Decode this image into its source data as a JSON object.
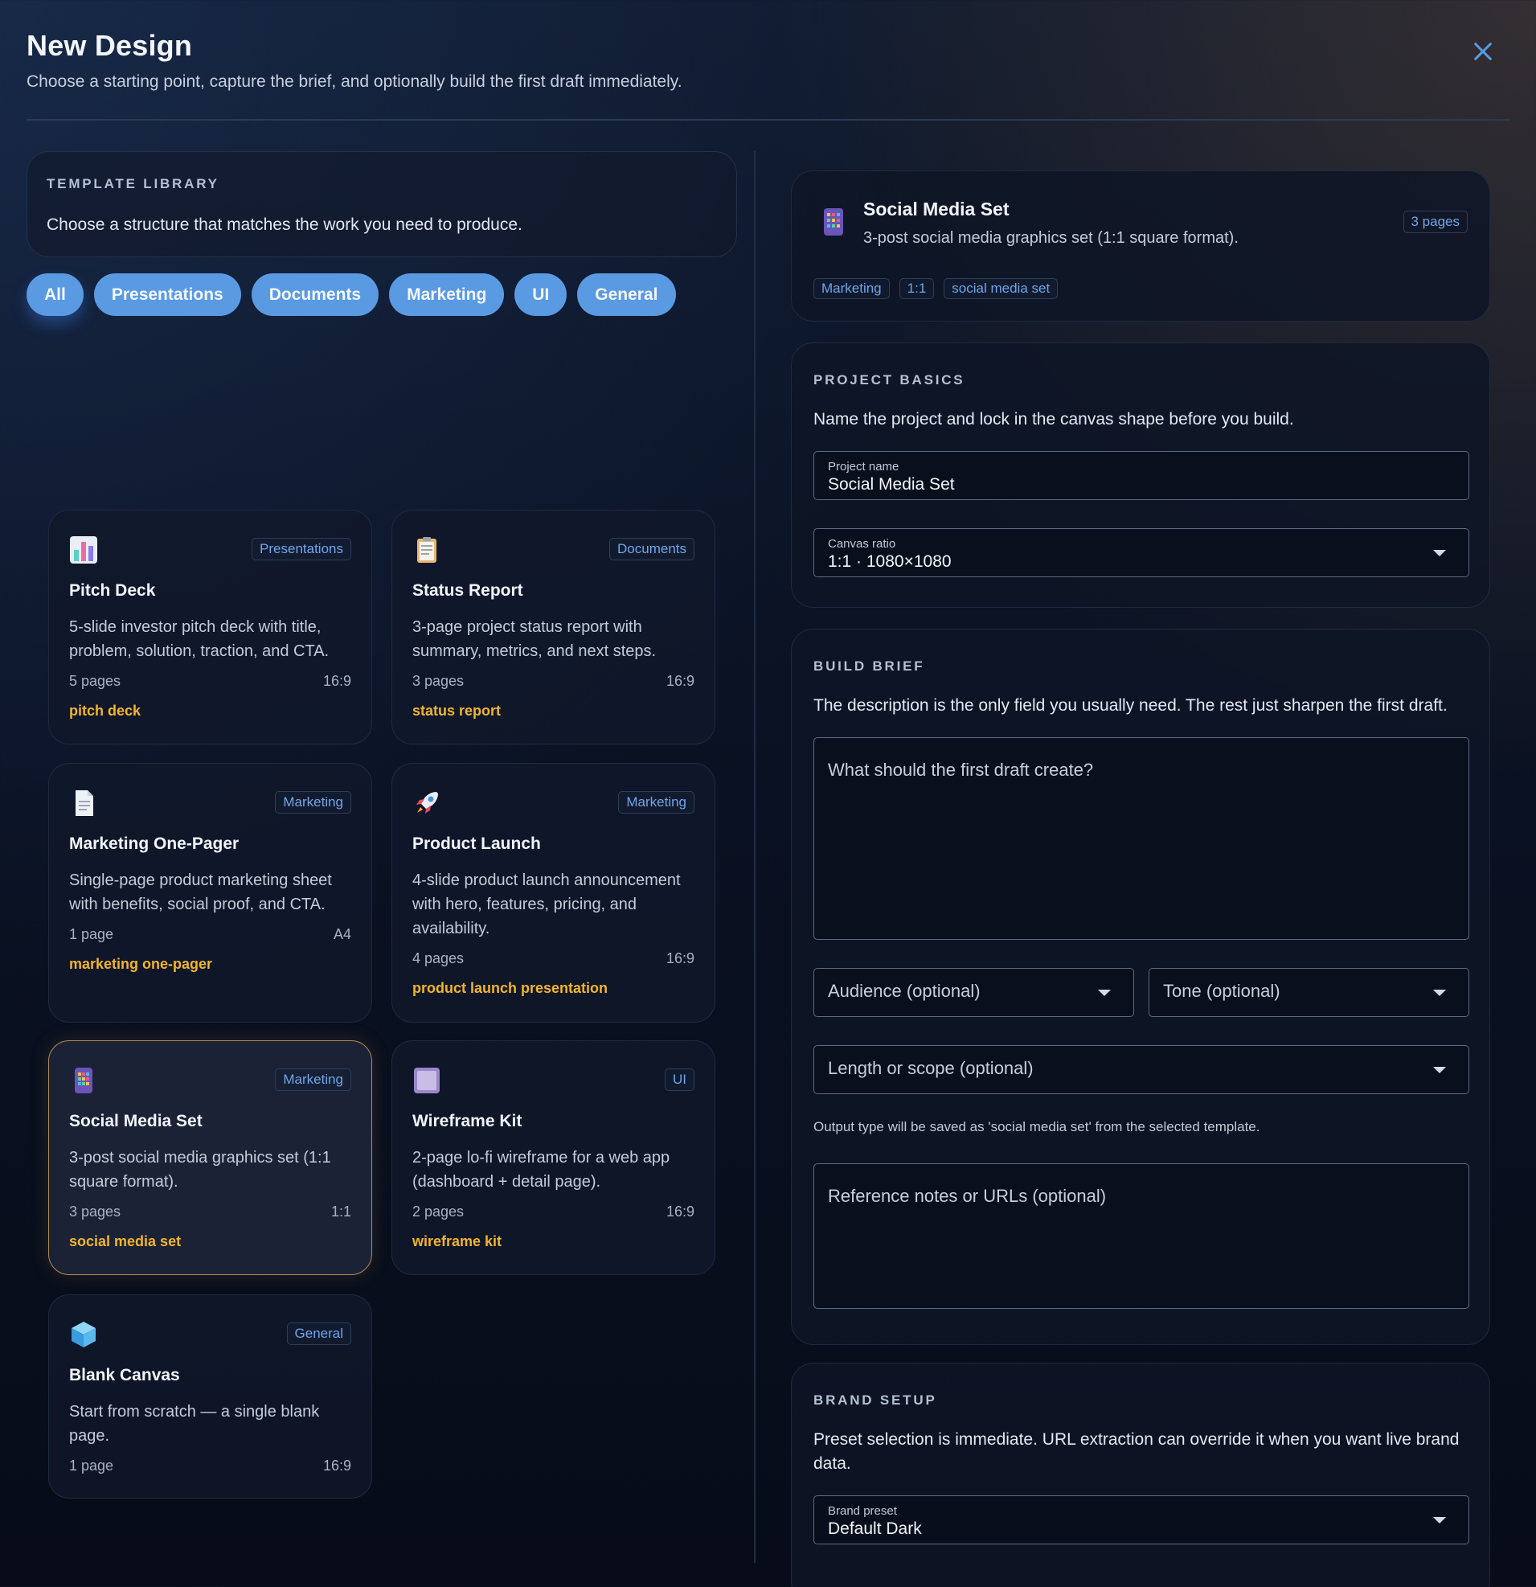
{
  "header": {
    "title": "New Design",
    "subtitle": "Choose a starting point, capture the brief, and optionally build the first draft immediately."
  },
  "library": {
    "label": "TEMPLATE LIBRARY",
    "description": "Choose a structure that matches the work you need to produce.",
    "filters": [
      "All",
      "Presentations",
      "Documents",
      "Marketing",
      "UI",
      "General"
    ],
    "active_filter": "All"
  },
  "templates": [
    {
      "icon": "bar-chart-icon",
      "tag": "Presentations",
      "title": "Pitch Deck",
      "desc": "5-slide investor pitch deck with title, problem, solution, traction, and CTA.",
      "pages": "5 pages",
      "ratio": "16:9",
      "type": "pitch deck"
    },
    {
      "icon": "clipboard-icon",
      "tag": "Documents",
      "title": "Status Report",
      "desc": "3-page project status report with summary, metrics, and next steps.",
      "pages": "3 pages",
      "ratio": "16:9",
      "type": "status report"
    },
    {
      "icon": "document-icon",
      "tag": "Marketing",
      "title": "Marketing One-Pager",
      "desc": "Single-page product marketing sheet with benefits, social proof, and CTA.",
      "pages": "1 page",
      "ratio": "A4",
      "type": "marketing one-pager"
    },
    {
      "icon": "rocket-icon",
      "tag": "Marketing",
      "title": "Product Launch",
      "desc": "4-slide product launch announcement with hero, features, pricing, and availability.",
      "pages": "4 pages",
      "ratio": "16:9",
      "type": "product launch presentation"
    },
    {
      "icon": "grid-phone-icon",
      "tag": "Marketing",
      "title": "Social Media Set",
      "desc": "3-post social media graphics set (1:1 square format).",
      "pages": "3 pages",
      "ratio": "1:1",
      "type": "social media set"
    },
    {
      "icon": "frame-icon",
      "tag": "UI",
      "title": "Wireframe Kit",
      "desc": "2-page lo-fi wireframe for a web app (dashboard + detail page).",
      "pages": "2 pages",
      "ratio": "16:9",
      "type": "wireframe kit"
    },
    {
      "icon": "cube-icon",
      "tag": "General",
      "title": "Blank Canvas",
      "desc": "Start from scratch — a single blank page.",
      "pages": "1 page",
      "ratio": "16:9",
      "type": ""
    }
  ],
  "selected": {
    "title": "Social Media Set",
    "desc": "3-post social media graphics set (1:1 square format).",
    "pages": "3 pages",
    "tags": [
      "Marketing",
      "1:1",
      "social media set"
    ]
  },
  "basics": {
    "label": "PROJECT BASICS",
    "description": "Name the project and lock in the canvas shape before you build.",
    "name_label": "Project name",
    "name_value": "Social Media Set",
    "ratio_label": "Canvas ratio",
    "ratio_value": "1:1 · 1080×1080"
  },
  "brief": {
    "label": "BUILD BRIEF",
    "description": "The description is the only field you usually need. The rest just sharpen the first draft.",
    "description_placeholder": "What should the first draft create?",
    "audience_placeholder": "Audience (optional)",
    "tone_placeholder": "Tone (optional)",
    "length_placeholder": "Length or scope (optional)",
    "note": "Output type will be saved as 'social media set' from the selected template.",
    "reference_placeholder": "Reference notes or URLs (optional)"
  },
  "brand": {
    "label": "BRAND SETUP",
    "description": "Preset selection is immediate. URL extraction can override it when you want live brand data.",
    "preset_label": "Brand preset",
    "preset_value": "Default Dark"
  },
  "colors": {
    "accent": "#5a9ae2",
    "type_label": "#f2b52a",
    "tag_text": "#6fa6ea",
    "selected_border": "#b18a57"
  }
}
